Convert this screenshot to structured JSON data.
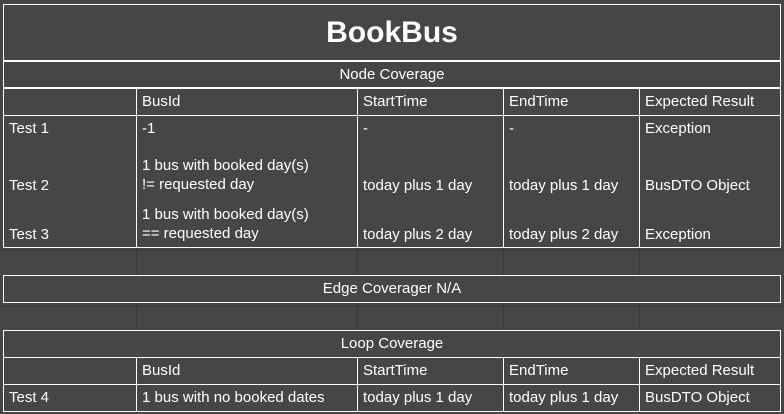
{
  "title": "BookBus",
  "node_section": {
    "heading": "Node Coverage",
    "columns": [
      "",
      "BusId",
      "StartTime",
      "EndTime",
      "Expected Result"
    ],
    "rows": [
      {
        "test": "Test 1",
        "busid": [
          "-1"
        ],
        "start": "-",
        "end": "-",
        "expected": "Exception"
      },
      {
        "test": "Test 2",
        "busid": [
          "1 bus with booked day(s)",
          "!= requested day"
        ],
        "start": "today plus 1 day",
        "end": "today plus 1 day",
        "expected": "BusDTO Object"
      },
      {
        "test": "Test 3",
        "busid": [
          "1 bus with booked day(s)",
          "== requested day"
        ],
        "start": "today plus 2 day",
        "end": "today plus 2 day",
        "expected": "Exception"
      }
    ]
  },
  "edge_section": {
    "heading": "Edge Coverager N/A"
  },
  "loop_section": {
    "heading": "Loop Coverage",
    "columns": [
      "",
      "BusId",
      "StartTime",
      "EndTime",
      "Expected Result"
    ],
    "rows": [
      {
        "test": "Test 4",
        "busid": [
          "1 bus with no booked dates"
        ],
        "start": "today plus 1 day",
        "end": "today plus 1 day",
        "expected": "BusDTO Object"
      }
    ]
  }
}
